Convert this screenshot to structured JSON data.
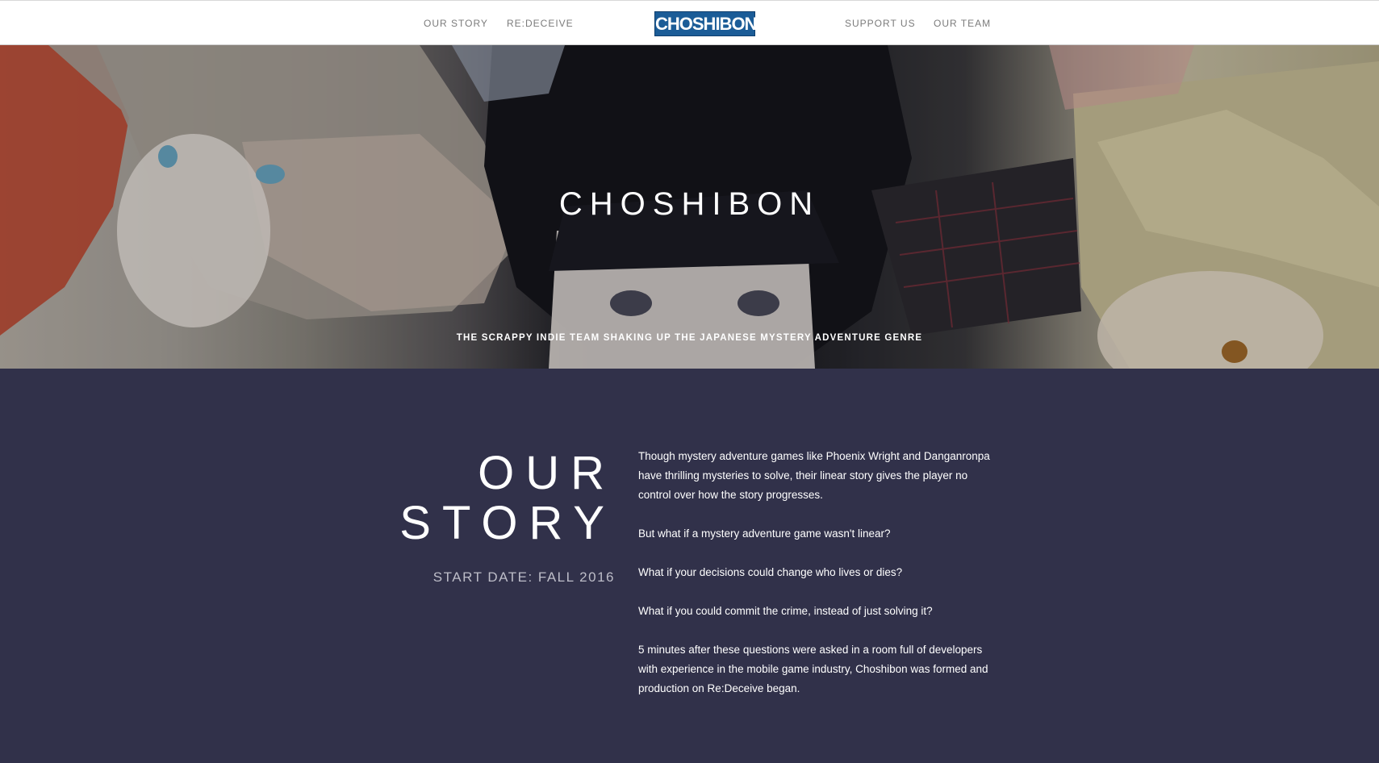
{
  "nav": {
    "left_links": [
      "OUR STORY",
      "RE:DECEIVE"
    ],
    "logo": "CHOSHIBON",
    "right_links": [
      "SUPPORT US",
      "OUR TEAM"
    ]
  },
  "hero": {
    "title": "CHOSHIBON",
    "subtitle": "THE SCRAPPY INDIE TEAM SHAKING UP THE JAPANESE MYSTERY ADVENTURE GENRE"
  },
  "story": {
    "heading_line1": "OUR",
    "heading_line2": "STORY",
    "start_date": "START DATE: FALL 2016",
    "paragraphs": [
      "Though mystery adventure games like Phoenix Wright and Danganronpa have thrilling mysteries to solve, their linear story gives the player no control over how the story progresses.",
      "But what if a mystery adventure game wasn't linear?",
      "What if your decisions could change who lives or dies?",
      "What if you could commit the crime, instead of just solving it?",
      "5 minutes after these questions were asked in a room full of developers with experience in the mobile game industry, Choshibon was formed and production on Re:Deceive began."
    ]
  },
  "colors": {
    "section_bg": "#31314a",
    "logo_bg": "#1b5c97",
    "nav_text": "#7b7b7b"
  }
}
